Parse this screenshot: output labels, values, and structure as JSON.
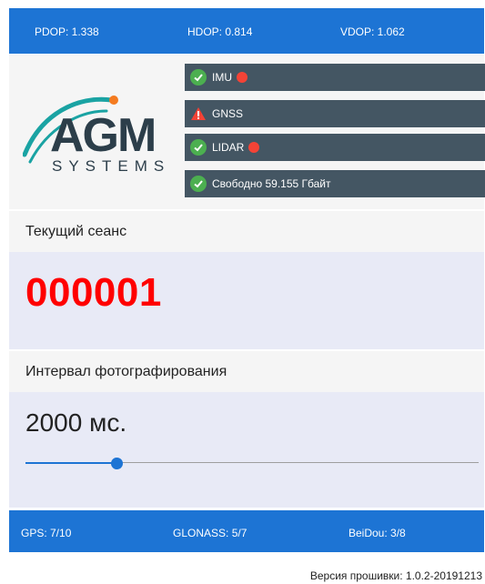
{
  "top_bar": {
    "pdop": "PDOP: 1.338",
    "hdop": "HDOP: 0.814",
    "vdop": "VDOP: 1.062"
  },
  "logo": {
    "line1": "AGM",
    "line2": "SYSTEMS",
    "colors": {
      "arc": "#1aa3a3",
      "dot": "#f47b20",
      "text": "#2c3e4a"
    }
  },
  "status": {
    "imu": {
      "label": "IMU",
      "icon": "check-circle-icon",
      "indicator": "red"
    },
    "gnss": {
      "label": "GNSS",
      "icon": "warning-triangle-icon"
    },
    "lidar": {
      "label": "LIDAR",
      "icon": "check-circle-icon",
      "indicator": "red"
    },
    "storage": {
      "label": "Свободно 59.155 Гбайт",
      "icon": "check-circle-icon"
    }
  },
  "session": {
    "header": "Текущий сеанс",
    "number": "000001"
  },
  "interval": {
    "header": "Интервал фотографирования",
    "value": "2000 мс.",
    "slider_fraction": 0.2
  },
  "bottom_bar": {
    "gps": "GPS: 7/10",
    "glonass": "GLONASS: 5/7",
    "beidou": "BeiDou: 3/8"
  },
  "footer": {
    "firmware": "Версия прошивки: 1.0.2-20191213"
  },
  "colors": {
    "primary": "#1d74d4",
    "status_bg": "#445663",
    "ok": "#4caf50",
    "alert": "#f44336",
    "session_number": "#ff0000"
  }
}
